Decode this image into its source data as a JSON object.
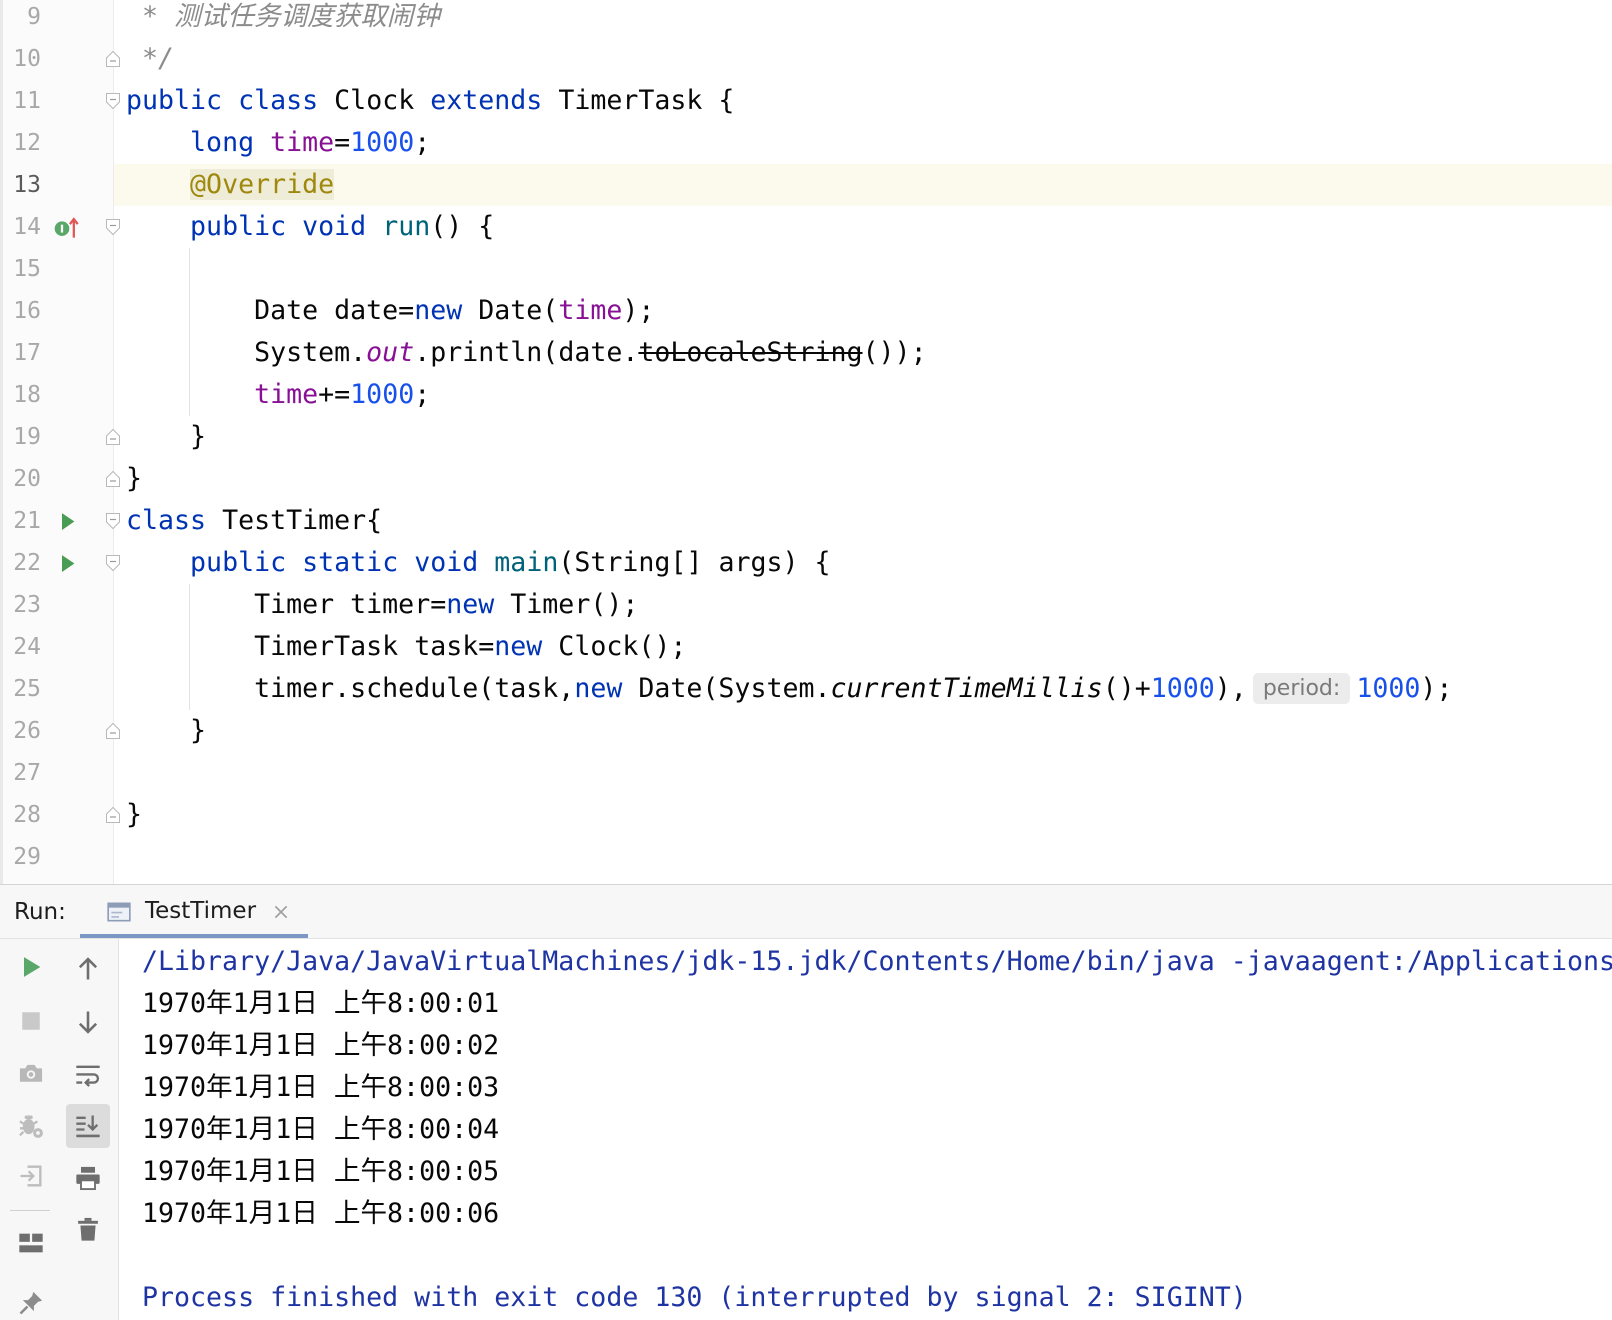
{
  "editor": {
    "lines": [
      {
        "num": "9",
        "tokens": [
          {
            "t": " * 测试任务调度获取闹钟",
            "k": "comment"
          }
        ]
      },
      {
        "num": "10",
        "fold": "fold-end-icon",
        "tokens": [
          {
            "t": " */",
            "k": "comment"
          }
        ]
      },
      {
        "num": "11",
        "fold": "fold-start-icon",
        "tokens": [
          {
            "t": "public",
            "k": "kw"
          },
          {
            "t": " "
          },
          {
            "t": "class",
            "k": "kw"
          },
          {
            "t": " Clock "
          },
          {
            "t": "extends",
            "k": "kw"
          },
          {
            "t": " TimerTask {"
          }
        ]
      },
      {
        "num": "12",
        "tokens": [
          {
            "t": "    "
          },
          {
            "t": "long",
            "k": "kw"
          },
          {
            "t": " "
          },
          {
            "t": "time",
            "k": "field"
          },
          {
            "t": "="
          },
          {
            "t": "1000",
            "k": "num"
          },
          {
            "t": ";"
          }
        ]
      },
      {
        "num": "13",
        "current": true,
        "tokens": [
          {
            "t": "    "
          },
          {
            "t": "@Override",
            "k": "annotation"
          }
        ]
      },
      {
        "num": "14",
        "marker": "override-icon",
        "fold": "fold-start-icon",
        "tokens": [
          {
            "t": "    "
          },
          {
            "t": "public",
            "k": "kw"
          },
          {
            "t": " "
          },
          {
            "t": "void",
            "k": "kw"
          },
          {
            "t": " "
          },
          {
            "t": "run",
            "k": "method"
          },
          {
            "t": "() {"
          }
        ]
      },
      {
        "num": "15",
        "tokens": []
      },
      {
        "num": "16",
        "tokens": [
          {
            "t": "        Date date="
          },
          {
            "t": "new",
            "k": "kw"
          },
          {
            "t": " Date("
          },
          {
            "t": "time",
            "k": "field"
          },
          {
            "t": ");"
          }
        ]
      },
      {
        "num": "17",
        "tokens": [
          {
            "t": "        System."
          },
          {
            "t": "out",
            "k": "static-field"
          },
          {
            "t": ".println(date."
          },
          {
            "t": "toLocaleString",
            "k": "deprecated"
          },
          {
            "t": "());"
          }
        ]
      },
      {
        "num": "18",
        "tokens": [
          {
            "t": "        "
          },
          {
            "t": "time",
            "k": "field"
          },
          {
            "t": "+="
          },
          {
            "t": "1000",
            "k": "num"
          },
          {
            "t": ";"
          }
        ]
      },
      {
        "num": "19",
        "fold": "fold-end-icon",
        "tokens": [
          {
            "t": "    }"
          }
        ]
      },
      {
        "num": "20",
        "fold": "fold-end-icon",
        "tokens": [
          {
            "t": "}"
          }
        ]
      },
      {
        "num": "21",
        "marker": "run-icon",
        "fold": "fold-start-icon",
        "tokens": [
          {
            "t": "class",
            "k": "kw"
          },
          {
            "t": " TestTimer{"
          }
        ]
      },
      {
        "num": "22",
        "marker": "run-icon",
        "fold": "fold-start-icon",
        "tokens": [
          {
            "t": "    "
          },
          {
            "t": "public",
            "k": "kw"
          },
          {
            "t": " "
          },
          {
            "t": "static",
            "k": "kw"
          },
          {
            "t": " "
          },
          {
            "t": "void",
            "k": "kw"
          },
          {
            "t": " "
          },
          {
            "t": "main",
            "k": "method"
          },
          {
            "t": "(String[] args) {"
          }
        ]
      },
      {
        "num": "23",
        "tokens": [
          {
            "t": "        Timer timer="
          },
          {
            "t": "new",
            "k": "kw"
          },
          {
            "t": " Timer();"
          }
        ]
      },
      {
        "num": "24",
        "tokens": [
          {
            "t": "        TimerTask task="
          },
          {
            "t": "new",
            "k": "kw"
          },
          {
            "t": " Clock();"
          }
        ]
      },
      {
        "num": "25",
        "tokens": [
          {
            "t": "        timer.schedule(task,"
          },
          {
            "t": "new",
            "k": "kw"
          },
          {
            "t": " Date(System."
          },
          {
            "t": "currentTimeMillis",
            "k": "static-method"
          },
          {
            "t": "()+"
          },
          {
            "t": "1000",
            "k": "num"
          },
          {
            "t": "),"
          },
          {
            "t": "period:",
            "k": "hint"
          },
          {
            "t": "1000",
            "k": "num"
          },
          {
            "t": ");"
          }
        ]
      },
      {
        "num": "26",
        "fold": "fold-end-icon",
        "tokens": [
          {
            "t": "    }"
          }
        ]
      },
      {
        "num": "27",
        "tokens": []
      },
      {
        "num": "28",
        "fold": "fold-end-icon",
        "tokens": [
          {
            "t": "}"
          }
        ]
      },
      {
        "num": "29",
        "tokens": []
      }
    ]
  },
  "run_panel": {
    "label": "Run:",
    "tab_title": "TestTimer",
    "tab_icon": "console-icon",
    "close_icon": "close-icon",
    "toolbar_left": [
      {
        "name": "rerun-button",
        "icon": "play-icon"
      },
      {
        "name": "stop-button",
        "icon": "stop-icon"
      },
      {
        "name": "dump-threads-button",
        "icon": "camera-icon"
      },
      {
        "name": "attach-debugger-button",
        "icon": "bug-icon"
      },
      {
        "name": "exit-button",
        "icon": "exit-icon"
      },
      {
        "name": "layout-button",
        "icon": "layout-icon"
      },
      {
        "name": "pin-tab-button",
        "icon": "pin-icon"
      }
    ],
    "toolbar_right": [
      {
        "name": "up-stack-trace-button",
        "icon": "arrow-up-icon"
      },
      {
        "name": "down-stack-trace-button",
        "icon": "arrow-down-icon"
      },
      {
        "name": "soft-wrap-button",
        "icon": "soft-wrap-icon"
      },
      {
        "name": "scroll-to-end-button",
        "icon": "scroll-to-end-icon",
        "active": true
      },
      {
        "name": "print-button",
        "icon": "print-icon"
      },
      {
        "name": "clear-all-button",
        "icon": "trash-icon"
      }
    ],
    "console": [
      {
        "text": "/Library/Java/JavaVirtualMachines/jdk-15.jdk/Contents/Home/bin/java -javaagent:/Applications",
        "kind": "system"
      },
      {
        "text": "1970年1月1日 上午8:00:01",
        "kind": "out"
      },
      {
        "text": "1970年1月1日 上午8:00:02",
        "kind": "out"
      },
      {
        "text": "1970年1月1日 上午8:00:03",
        "kind": "out"
      },
      {
        "text": "1970年1月1日 上午8:00:04",
        "kind": "out"
      },
      {
        "text": "1970年1月1日 上午8:00:05",
        "kind": "out"
      },
      {
        "text": "1970年1月1日 上午8:00:06",
        "kind": "out"
      },
      {
        "text": "",
        "kind": "out"
      },
      {
        "text": "Process finished with exit code 130 (interrupted by signal 2: SIGINT)",
        "kind": "system"
      }
    ]
  },
  "colors": {
    "keyword": "#0033b3",
    "field": "#871094",
    "number": "#1750eb",
    "annotation": "#9e880d",
    "method": "#00627a",
    "comment": "#8c8c8c",
    "text": "#080808",
    "console_system": "#1f34a3",
    "current_line": "#fcfaed",
    "run_icon": "#499c54",
    "tab_underline": "#7b98c4"
  }
}
